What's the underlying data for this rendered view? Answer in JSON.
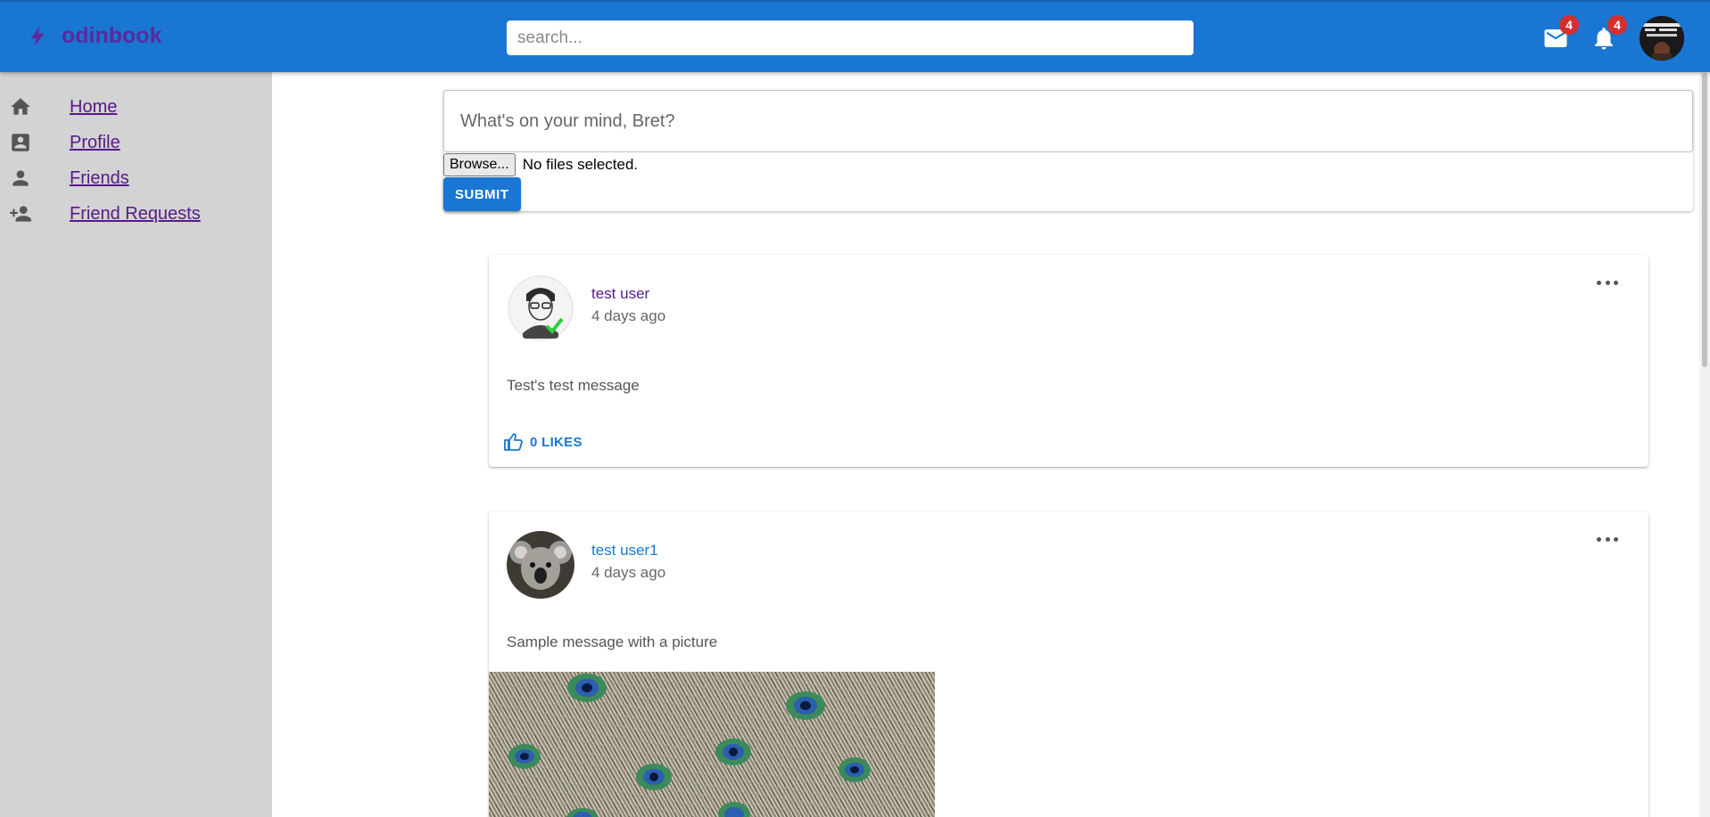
{
  "app": {
    "name": "odinbook",
    "search_placeholder": "search...",
    "mail_badge": "4",
    "notifications_badge": "4",
    "brand_color": "#1976d2"
  },
  "sidebar": {
    "items": [
      {
        "label": "Home",
        "icon": "home-icon"
      },
      {
        "label": "Profile",
        "icon": "profile-icon"
      },
      {
        "label": "Friends",
        "icon": "person-icon"
      },
      {
        "label": "Friend Requests",
        "icon": "person-add-icon"
      }
    ]
  },
  "composer": {
    "placeholder": "What's on your mind, Bret?",
    "browse_label": "Browse...",
    "file_status": "No files selected.",
    "submit_label": "SUBMIT"
  },
  "posts": [
    {
      "author": "test user",
      "time": "4 days ago",
      "text": "Test's test message",
      "likes_label": "0 LIKES"
    },
    {
      "author": "test user1",
      "time": "4 days ago",
      "text": "Sample message with a picture"
    }
  ]
}
